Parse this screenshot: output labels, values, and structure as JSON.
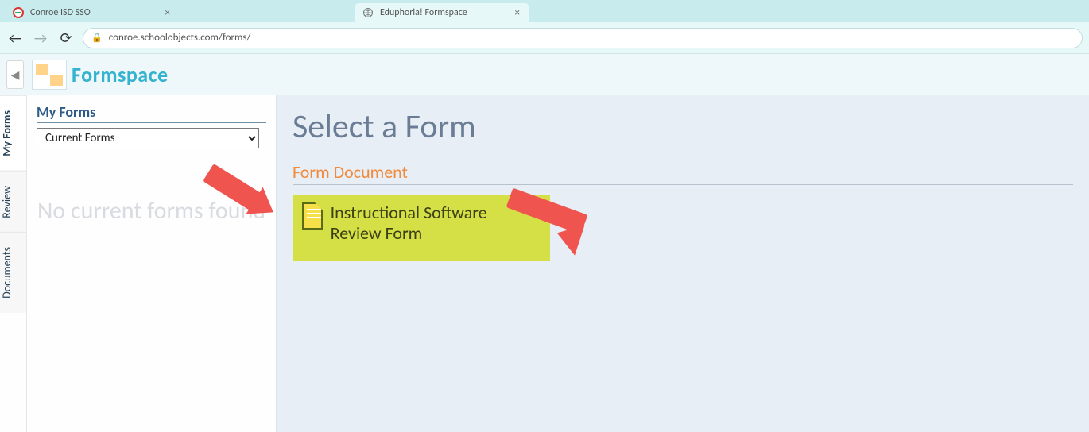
{
  "browser": {
    "tabs": [
      {
        "title": "Conroe ISD SSO",
        "active": false
      },
      {
        "title": "",
        "active": false
      },
      {
        "title": "Eduphoria! Formspace",
        "active": true
      }
    ],
    "url": "conroe.schoolobjects.com/forms/"
  },
  "app": {
    "title": "Formspace"
  },
  "side_tabs": [
    {
      "label": "My Forms",
      "active": true
    },
    {
      "label": "Review",
      "active": false
    },
    {
      "label": "Documents",
      "active": false
    }
  ],
  "left_panel": {
    "heading": "My Forms",
    "dropdown_selected": "Current Forms",
    "empty_message": "No current forms found"
  },
  "main": {
    "title": "Select a Form",
    "section_heading": "Form Document",
    "form_name": "Instructional Software Review Form"
  }
}
